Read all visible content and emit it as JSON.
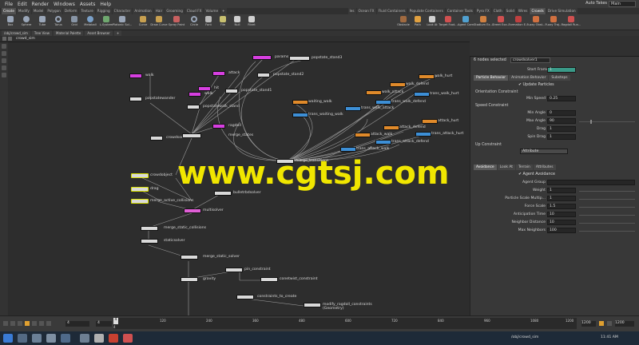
{
  "menu": [
    "File",
    "Edit",
    "Render",
    "Windows",
    "Assets",
    "Help"
  ],
  "desktop_label": "Auto Takes",
  "desktop_select": "Main",
  "shelf_tabs_left": [
    "Create",
    "Modify",
    "Model",
    "Polygon",
    "Deform",
    "Texture",
    "Rigging",
    "Character",
    "Animation",
    "Hair",
    "Grooming",
    "Cloud FX",
    "Volume",
    "+"
  ],
  "shelf_tabs_right": [
    "Ies",
    "Ocean FX",
    "Fluid Containers",
    "Populate Containers",
    "Container Tools",
    "Pyro FX",
    "Cloth",
    "Solid",
    "Wires",
    "Crowds",
    "Drive Simulation"
  ],
  "tools_left": [
    "Box",
    "Sphere",
    "Tube",
    "Torus",
    "Grid",
    "Metaball",
    "L-System",
    "Platonic Sol...",
    "Curve",
    "Draw Curve",
    "Spray Paint",
    "Circle",
    "Font",
    "File",
    "Null",
    "Rivet"
  ],
  "tools_right": [
    "Obstacle",
    "Path",
    "Look At",
    "Target Foot...",
    "Agent Cam",
    "Stadium Ex...",
    "Street Exa...",
    "Formation E...",
    "Fuzzy Obst...",
    "Fuzzy Traj...",
    "Ragdoll Run..."
  ],
  "path_tabs": [
    "/obj/crowd_sim",
    "Tree View",
    "Material Palette",
    "Asset Browser",
    "+"
  ],
  "breadcrumb": "crowd_sim",
  "nodes": [
    {
      "label": "walk",
      "color": "#d63fe0"
    },
    {
      "label": "popstatewander",
      "color": "#d9d9d9"
    },
    {
      "label": "attack",
      "color": "#d63fe0"
    },
    {
      "label": "hit",
      "color": "#d63fe0"
    },
    {
      "label": "walk",
      "color": "#d63fe0"
    },
    {
      "label": "popstatewalk_stand",
      "color": "#d9d9d9"
    },
    {
      "label": "crowdsource",
      "color": "#d9d9d9"
    },
    {
      "label": "ragdoll",
      "color": "#d63fe0"
    },
    {
      "label": "merge_states",
      "color": "#d9d9d9"
    },
    {
      "label": "popstate_stand3",
      "color": "#d9d9d9"
    },
    {
      "label": "popstate_stand2",
      "color": "#d9d9d9"
    },
    {
      "label": "popstate_stand1",
      "color": "#d9d9d9"
    },
    {
      "label": "walk_hurt",
      "color": "#e08a2a"
    },
    {
      "label": "walk_defend",
      "color": "#e08a2a"
    },
    {
      "label": "walk_attack",
      "color": "#e08a2a"
    },
    {
      "label": "trans_walk_hurt",
      "color": "#3d8fd6"
    },
    {
      "label": "trans_walk_defend",
      "color": "#3d8fd6"
    },
    {
      "label": "waiting_walk",
      "color": "#e08a2a"
    },
    {
      "label": "trans_waiting_walk",
      "color": "#3d8fd6"
    },
    {
      "label": "trans_walk_attack",
      "color": "#3d8fd6"
    },
    {
      "label": "attack_hurt",
      "color": "#e08a2a"
    },
    {
      "label": "attack_defend",
      "color": "#e08a2a"
    },
    {
      "label": "trans_attack_hurt",
      "color": "#3d8fd6"
    },
    {
      "label": "attack_walk",
      "color": "#e08a2a"
    },
    {
      "label": "trans_attack_defend",
      "color": "#3d8fd6"
    },
    {
      "label": "trans_attack_walk",
      "color": "#3d8fd6"
    },
    {
      "label": "merge_transitions",
      "color": "#d9d9d9"
    },
    {
      "label": "crowdobject",
      "color": "#d9d9d9"
    },
    {
      "label": "drag",
      "color": "#d9d9d9"
    },
    {
      "label": "merge_active_collisions",
      "color": "#d9d9d9"
    },
    {
      "label": "bulletrbdsolver",
      "color": "#d9d9d9"
    },
    {
      "label": "multisolver",
      "color": "#e05fd6"
    },
    {
      "label": "merge_static_collisions",
      "color": "#d9d9d9"
    },
    {
      "label": "staticsolver",
      "color": "#d9d9d9"
    },
    {
      "label": "merge_static_solver",
      "color": "#d9d9d9"
    },
    {
      "label": "pin_constraint",
      "color": "#d9d9d9"
    },
    {
      "label": "gravity",
      "color": "#d9d9d9"
    },
    {
      "label": "conetwist_constraint",
      "color": "#d9d9d9"
    },
    {
      "label": "constraints_to_create",
      "color": "#d9d9d9"
    },
    {
      "label": "modify_ragdoll_constraints (Geometry)",
      "color": "#d9d9d9"
    },
    {
      "label": "params",
      "color": "#d63fe0"
    }
  ],
  "watermark": "www.cgtsj.com",
  "params": {
    "header": "6 nodes selected",
    "node_name": "crowdsolver1",
    "start_frame_label": "Start Frame",
    "start_frame": "1",
    "tabs_top": [
      "Particle Behavior",
      "Animation Behavior",
      "Substeps"
    ],
    "update_particles": "Update Particles",
    "orientation_constraint": "Orientation Constraint",
    "min_speed_label": "Min Speed",
    "min_speed": "0.25",
    "speed_constraint": "Speed Constraint",
    "min_angle_label": "Min Angle",
    "min_angle": "0",
    "max_angle_label": "Max Angle",
    "max_angle": "90",
    "drag_label": "Drag",
    "drag": "1",
    "spin_drag_label": "Spin Drag",
    "spin_drag": "1",
    "up_constraint": "Up Constraint",
    "source_label": "Source",
    "source": "Attribute",
    "tabs_bottom": [
      "Avoidance",
      "Look At",
      "Terrain",
      "Attributes"
    ],
    "agent_avoidance": "Agent Avoidance",
    "agent_group_label": "Agent Group",
    "weight_label": "Weight",
    "weight": "1",
    "pscale_label": "Particle Scale Multip...",
    "pscale": "1",
    "force_scale_label": "Force Scale",
    "force_scale": "1.5",
    "anticipation_label": "Anticipation Time",
    "anticipation": "10",
    "neighbor_label": "Neighbor Distance",
    "neighbor": "10",
    "max_neighbors_label": "Max Neighbors",
    "max_neighbors": "100"
  },
  "timeline": {
    "frame": "4",
    "step": "4",
    "start": "1",
    "ticks": [
      "4",
      "120",
      "240",
      "360",
      "480",
      "600",
      "720",
      "840",
      "960",
      "1080",
      "1200"
    ],
    "end": "1200",
    "end2": "1200",
    "current_frame_marker": "4",
    "auto_update": "Auto Update"
  },
  "taskbar": {
    "item": "/obj/crowd_sim",
    "time": "11:41 AM"
  }
}
